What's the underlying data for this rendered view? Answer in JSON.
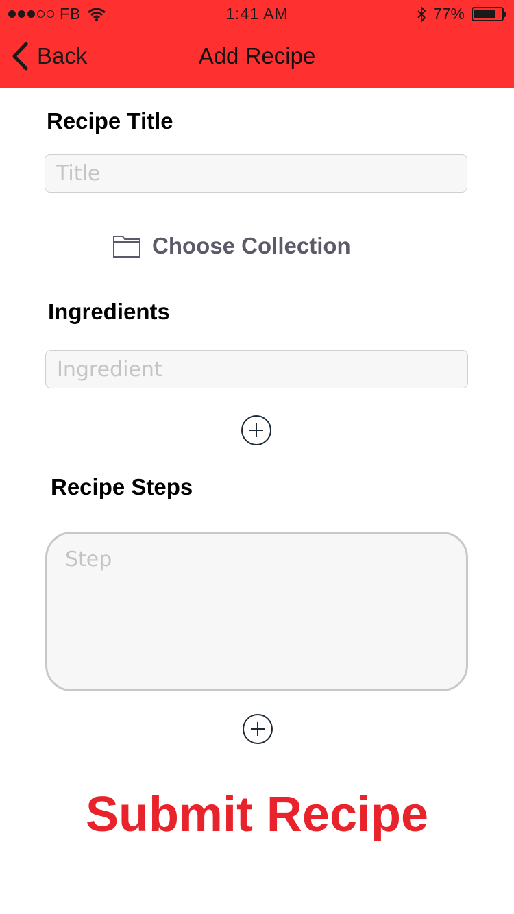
{
  "status_bar": {
    "carrier": "FB",
    "time": "1:41 AM",
    "battery_percent": "77%",
    "battery_level": 0.77,
    "signal_bars_filled": 3,
    "signal_bars_total": 5
  },
  "nav": {
    "back_label": "Back",
    "title": "Add Recipe",
    "background_color": "#ff3030"
  },
  "form": {
    "title_label": "Recipe Title",
    "title_placeholder": "Title",
    "choose_collection_label": "Choose Collection",
    "ingredients_label": "Ingredients",
    "ingredient_placeholder": "Ingredient",
    "steps_label": "Recipe Steps",
    "step_placeholder": "Step"
  },
  "submit_label": "Submit Recipe",
  "colors": {
    "submit": "#e8232b",
    "collection_text": "#5a5a68"
  },
  "icons": [
    "back-chevron",
    "folder",
    "add-circle",
    "wifi",
    "bluetooth",
    "battery"
  ]
}
